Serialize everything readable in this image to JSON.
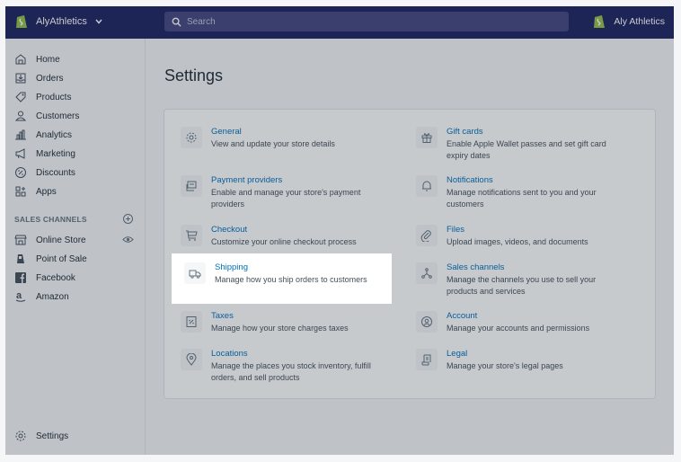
{
  "topbar": {
    "store_name": "AlyAthletics",
    "search_placeholder": "Search",
    "user_name": "Aly Athletics"
  },
  "sidebar": {
    "items": [
      {
        "label": "Home",
        "icon": "home-icon"
      },
      {
        "label": "Orders",
        "icon": "orders-icon"
      },
      {
        "label": "Products",
        "icon": "tag-icon"
      },
      {
        "label": "Customers",
        "icon": "person-icon"
      },
      {
        "label": "Analytics",
        "icon": "bar-chart-icon"
      },
      {
        "label": "Marketing",
        "icon": "megaphone-icon"
      },
      {
        "label": "Discounts",
        "icon": "discount-icon"
      },
      {
        "label": "Apps",
        "icon": "apps-icon"
      }
    ],
    "sales_channels_label": "SALES CHANNELS",
    "channels": [
      {
        "label": "Online Store",
        "icon": "store-icon"
      },
      {
        "label": "Point of Sale",
        "icon": "pos-icon"
      },
      {
        "label": "Facebook",
        "icon": "facebook-icon"
      },
      {
        "label": "Amazon",
        "icon": "amazon-icon"
      }
    ],
    "settings_label": "Settings"
  },
  "main": {
    "title": "Settings",
    "tiles_left": [
      {
        "title": "General",
        "desc": "View and update your store details",
        "icon": "gear-icon"
      },
      {
        "title": "Payment providers",
        "desc": "Enable and manage your store's payment providers",
        "icon": "payment-icon"
      },
      {
        "title": "Checkout",
        "desc": "Customize your online checkout process",
        "icon": "cart-icon"
      },
      {
        "title": "Shipping",
        "desc": "Manage how you ship orders to customers",
        "icon": "truck-icon"
      },
      {
        "title": "Taxes",
        "desc": "Manage how your store charges taxes",
        "icon": "tax-icon"
      },
      {
        "title": "Locations",
        "desc": "Manage the places you stock inventory, fulfill orders, and sell products",
        "icon": "location-icon"
      }
    ],
    "tiles_right": [
      {
        "title": "Gift cards",
        "desc": "Enable Apple Wallet passes and set gift card expiry dates",
        "icon": "gift-icon"
      },
      {
        "title": "Notifications",
        "desc": "Manage notifications sent to you and your customers",
        "icon": "bell-icon"
      },
      {
        "title": "Files",
        "desc": "Upload images, videos, and documents",
        "icon": "paperclip-icon"
      },
      {
        "title": "Sales channels",
        "desc": "Manage the channels you use to sell your products and services",
        "icon": "channels-icon"
      },
      {
        "title": "Account",
        "desc": "Manage your accounts and permissions",
        "icon": "account-icon"
      },
      {
        "title": "Legal",
        "desc": "Manage your store's legal pages",
        "icon": "legal-icon"
      }
    ]
  },
  "colors": {
    "topbar": "#1c2260",
    "link": "#006fbb",
    "brand_green": "#95bf47"
  }
}
